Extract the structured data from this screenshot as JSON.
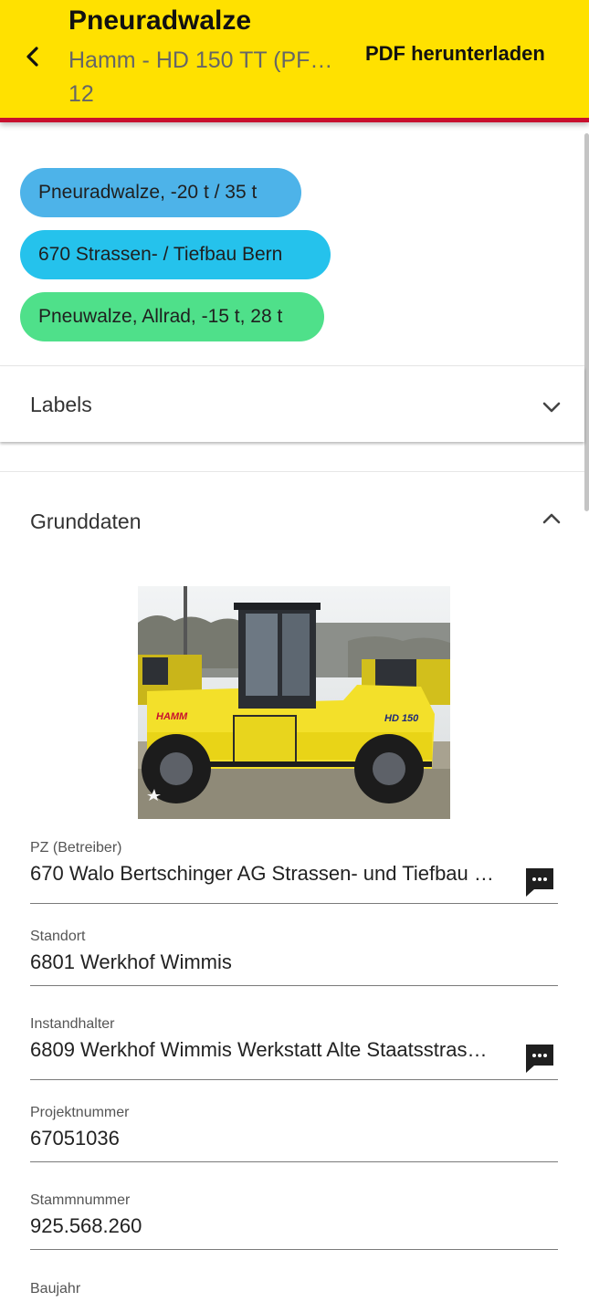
{
  "header": {
    "title": "Pneuradwalze",
    "subtitle_line1": "Hamm - HD 150 TT (PF…",
    "subtitle_line2": "12",
    "pdf_label": "PDF herunterladen",
    "bg_color": "#ffe100",
    "border_color": "#c8102e"
  },
  "chips": [
    {
      "label": "Pneuradwalze, -20 t / 35 t",
      "color": "#4db3e9"
    },
    {
      "label": "670 Strassen- / Tiefbau Bern",
      "color": "#25c2ec"
    },
    {
      "label": "Pneuwalze, Allrad, -15 t, 28 t",
      "color": "#4fe08a"
    }
  ],
  "sections": {
    "labels": {
      "title": "Labels",
      "expanded": false,
      "icon": "chevron-down-icon"
    },
    "grunddaten": {
      "title": "Grunddaten",
      "expanded": true,
      "icon": "chevron-up-icon"
    }
  },
  "photo": {
    "icon": "machine-photo",
    "brand_text": "HAMM",
    "model_text": "HD 150"
  },
  "fields": [
    {
      "label": "PZ (Betreiber)",
      "value": "670 Walo Bertschinger AG Strassen- und Tiefbau …",
      "has_comment": true
    },
    {
      "label": "Standort",
      "value": "6801 Werkhof Wimmis",
      "has_comment": false
    },
    {
      "label": "Instandhalter",
      "value": "6809 Werkhof Wimmis Werkstatt Alte Staatsstras…",
      "has_comment": true
    },
    {
      "label": "Projektnummer",
      "value": "67051036",
      "has_comment": false
    },
    {
      "label": "Stammnummer",
      "value": "925.568.260",
      "has_comment": false
    },
    {
      "label": "Baujahr",
      "value": "",
      "has_comment": false
    }
  ]
}
